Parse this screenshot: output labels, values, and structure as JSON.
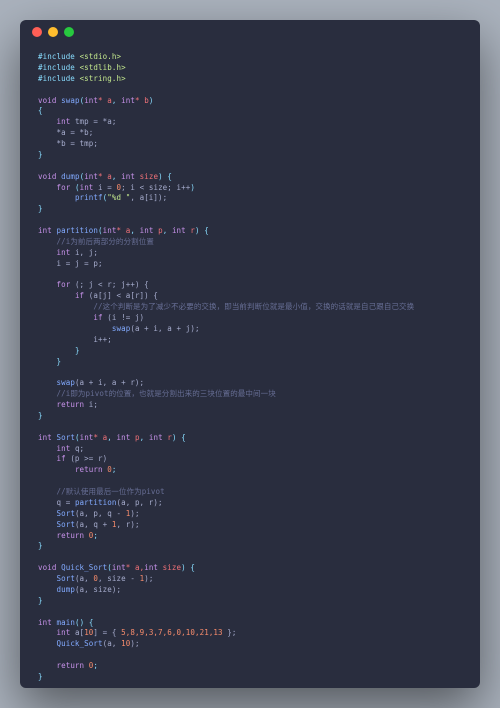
{
  "window": {
    "titlebar": {
      "close": "close",
      "minimize": "minimize",
      "maximize": "maximize"
    }
  },
  "code": {
    "inc1_kw": "#include",
    "inc1_hdr": "<stdio.h>",
    "inc2_kw": "#include",
    "inc2_hdr": "<stdlib.h>",
    "inc3_kw": "#include",
    "inc3_hdr": "<string.h>",
    "swap_ret": "void",
    "swap_name": "swap",
    "swap_p1t": "int",
    "swap_p1": "* a",
    "swap_p2t": "int",
    "swap_p2": "* b",
    "swap_l1a": "int",
    "swap_l1b": " tmp = *a;",
    "swap_l2": "*a = *b;",
    "swap_l3": "*b = tmp;",
    "dump_ret": "void",
    "dump_name": "dump",
    "dump_p1t": "int",
    "dump_p1": "* a",
    "dump_p2t": "int",
    "dump_p2": " size",
    "dump_for": "for",
    "dump_for_init_t": "int",
    "dump_for_init": " i = ",
    "dump_for_init_n": "0",
    "dump_for_cond": "; i < size; i++",
    "dump_printf": "printf",
    "dump_fmt": "\"%d \"",
    "dump_arg": ", a[i]);",
    "part_ret": "int",
    "part_name": "partition",
    "part_p1t": "int",
    "part_p1": "* a",
    "part_p2t": "int",
    "part_p2": " p",
    "part_p3t": "int",
    "part_p3": " r",
    "part_c1": "//i为前后两部分的分割位置",
    "part_l1t": "int",
    "part_l1": " i, j;",
    "part_l2": "i = j = p;",
    "part_for": "for",
    "part_for_body": " (; j < r; j++) {",
    "part_if1": "if",
    "part_if1_body": " (a[j] < a[r]) {",
    "part_c2": "//这个判断是为了减少不必要的交换，即当前判断位就是最小值，交换的话就是自己跟自己交换",
    "part_if2": "if",
    "part_if2_body": " (i != j)",
    "part_swapc": "swap",
    "part_swapc_arg": "(a + i, a + j);",
    "part_inc": "i++;",
    "part_swap2": "swap",
    "part_swap2_arg": "(a + i, a + r);",
    "part_c3": "//i即为pivot的位置，也就是分割出来的三块位置的最中间一块",
    "part_ret_kw": "return",
    "part_ret_v": " i;",
    "sort_ret": "int",
    "sort_name": "Sort",
    "sort_p1t": "int",
    "sort_p1": "* a",
    "sort_p2t": "int",
    "sort_p2": " p",
    "sort_p3t": "int",
    "sort_p3": " r",
    "sort_l1t": "int",
    "sort_l1": " q;",
    "sort_if": "if",
    "sort_if_body": " (p >= r)",
    "sort_ret0": "return",
    "sort_ret0_n": "0",
    "sort_c1": "//默认使用最后一位作为pivot",
    "sort_q": "q = ",
    "sort_qfn": "partition",
    "sort_qarg": "(a, p, r);",
    "sort_s1": "Sort",
    "sort_s1_arg_a": "(a, p, q - ",
    "sort_s1_arg_n": "1",
    "sort_s1_arg_b": ");",
    "sort_s2": "Sort",
    "sort_s2_arg_a": "(a, q + ",
    "sort_s2_arg_n": "1",
    "sort_s2_arg_b": ", r);",
    "sort_ret1": "return",
    "sort_ret1_n": "0",
    "qs_ret": "void",
    "qs_name": "Quick_Sort",
    "qs_p1t": "int",
    "qs_p1": "* a,",
    "qs_p2t": "int",
    "qs_p2": " size",
    "qs_s": "Sort",
    "qs_s_arg_a": "(a, ",
    "qs_s_arg_n": "0",
    "qs_s_arg_b": ", size - ",
    "qs_s_arg_n2": "1",
    "qs_s_arg_c": ");",
    "qs_d": "dump",
    "qs_d_arg": "(a, size);",
    "main_ret": "int",
    "main_name": "main",
    "main_arr_t": "int",
    "main_arr_a": " a[",
    "main_arr_sz": "10",
    "main_arr_b": "] = { ",
    "main_arr_vals": "5,8,9,3,7,6,0,10,21,13",
    "main_arr_c": " };",
    "main_qs": "Quick_Sort",
    "main_qs_arg_a": "(a, ",
    "main_qs_arg_n": "10",
    "main_qs_arg_b": ");",
    "main_ret_kw": "return",
    "main_ret_n": "0",
    "semicolon": ";",
    "brace_o": "{",
    "brace_c": "}",
    "paren_o": "(",
    "paren_c": ")",
    "comma": ", "
  }
}
